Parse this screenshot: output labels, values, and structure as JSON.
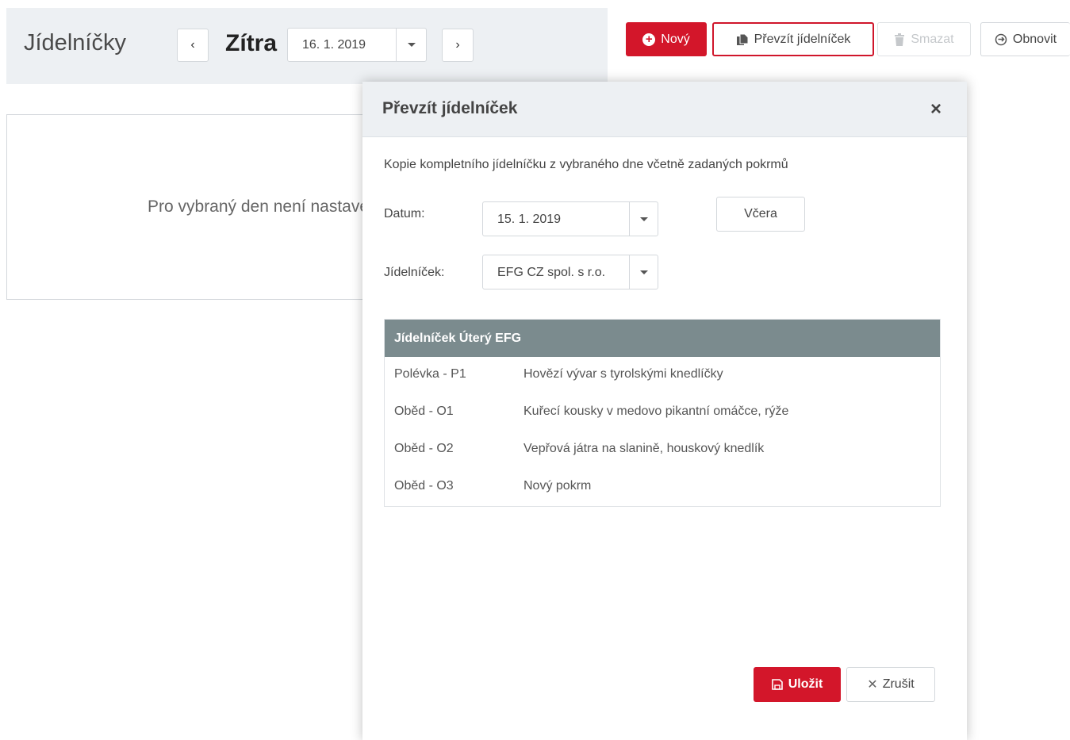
{
  "header": {
    "title": "Jídelníčky",
    "prev_icon": "‹",
    "next_icon": "›",
    "day_label": "Zítra",
    "date_value": "16. 1. 2019"
  },
  "toolbar": {
    "new_label": "Nový",
    "take_label": "Převzít jídelníček",
    "delete_label": "Smazat",
    "refresh_label": "Obnovit"
  },
  "main": {
    "empty_text": "Pro vybraný den není nastaven"
  },
  "modal": {
    "title": "Převzít jídelníček",
    "close_icon": "×",
    "description": "Kopie kompletního jídelníčku z vybraného dne včetně zadaných pokrmů",
    "date_label": "Datum:",
    "date_value": "15. 1. 2019",
    "yesterday_label": "Včera",
    "menu_label": "Jídelníček:",
    "menu_value": "EFG CZ spol. s r.o.",
    "table_header": "Jídelníček Úterý EFG",
    "rows": [
      {
        "course": "Polévka - P1",
        "dish": "Hovězí vývar s tyrolskými knedlíčky"
      },
      {
        "course": "Oběd - O1",
        "dish": "Kuřecí kousky v medovo pikantní omáčce, rýže"
      },
      {
        "course": "Oběd - O2",
        "dish": "Vepřová játra na slanině, houskový knedlík"
      },
      {
        "course": "Oběd - O3",
        "dish": "Nový pokrm"
      }
    ],
    "save_label": "Uložit",
    "cancel_label": "Zrušit",
    "cancel_icon": "✕"
  },
  "colors": {
    "accent": "#d3162a",
    "table_header_bg": "#7b8b8e",
    "header_bg": "#edf0f3"
  }
}
